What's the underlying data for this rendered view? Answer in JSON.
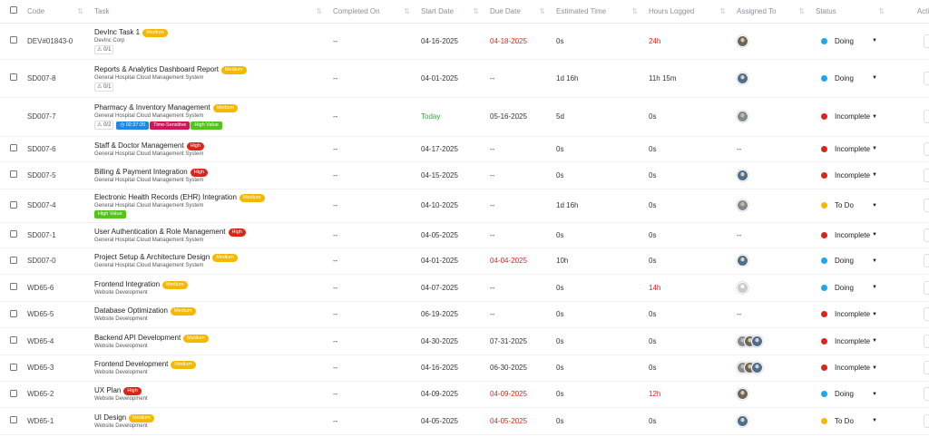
{
  "headers": {
    "code": "Code",
    "task": "Task",
    "completed": "Completed On",
    "start": "Start Date",
    "due": "Due Date",
    "estimated": "Estimated Time",
    "logged": "Hours Logged",
    "assigned": "Assigned To",
    "status": "Status",
    "action": "Action"
  },
  "colors": {
    "doing": "#1ea7e8",
    "incomplete": "#d9261c",
    "todo": "#f5b800",
    "medium": "#f5b800",
    "high": "#d9261c",
    "overdue": "#e0261c",
    "today": "#3aa33a"
  },
  "rows": [
    {
      "code": "DEV#01843-0",
      "task": "DevInc Task 1",
      "priority": "Medium",
      "project": "DevInc Corp",
      "subtasks": "0/1",
      "completed": "--",
      "start": "04-16-2025",
      "due": "04-18-2025",
      "due_overdue": true,
      "estimated": "0s",
      "logged": "24h",
      "logged_red": true,
      "assigned": "avatar",
      "status": "Doing",
      "status_key": "doing",
      "checkbox": true
    },
    {
      "code": "SD007-8",
      "task": "Reports & Analytics Dashboard Report",
      "priority": "Medium",
      "project": "General Hospital Cloud Management System",
      "subtasks": "0/1",
      "completed": "--",
      "start": "04-01-2025",
      "due": "--",
      "estimated": "1d 16h",
      "logged": "11h 15m",
      "assigned": "avatar",
      "status": "Doing",
      "status_key": "doing",
      "checkbox": true
    },
    {
      "code": "SD007-7",
      "task": "Pharmacy & Inventory Management",
      "priority": "Medium",
      "project": "General Hospital Cloud Management System",
      "subtasks": "0/2",
      "timer": "02:37:20",
      "labels": [
        "Time-Sensitive",
        "High Value"
      ],
      "completed": "--",
      "start": "Today",
      "start_today": true,
      "due": "05-16-2025",
      "estimated": "5d",
      "logged": "0s",
      "assigned": "avatar",
      "status": "Incomplete",
      "status_key": "incomplete",
      "checkbox": false
    },
    {
      "code": "SD007-6",
      "task": "Staff & Doctor Management",
      "priority": "High",
      "project": "General Hospital Cloud Management System",
      "completed": "--",
      "start": "04-17-2025",
      "due": "--",
      "estimated": "0s",
      "logged": "0s",
      "assigned": "--",
      "status": "Incomplete",
      "status_key": "incomplete",
      "checkbox": true
    },
    {
      "code": "SD007-5",
      "task": "Billing & Payment Integration",
      "priority": "High",
      "project": "General Hospital Cloud Management System",
      "completed": "--",
      "start": "04-15-2025",
      "due": "--",
      "estimated": "0s",
      "logged": "0s",
      "assigned": "avatar",
      "status": "Incomplete",
      "status_key": "incomplete",
      "checkbox": true
    },
    {
      "code": "SD007-4",
      "task": "Electronic Health Records (EHR) Integration",
      "priority": "Medium",
      "project": "General Hospital Cloud Management System",
      "labels": [
        "High Value"
      ],
      "completed": "--",
      "start": "04-10-2025",
      "due": "--",
      "estimated": "1d 16h",
      "logged": "0s",
      "assigned": "avatar",
      "status": "To Do",
      "status_key": "todo",
      "checkbox": true
    },
    {
      "code": "SD007-1",
      "task": "User Authentication & Role Management",
      "priority": "High",
      "project": "General Hospital Cloud Management System",
      "completed": "--",
      "start": "04-05-2025",
      "due": "--",
      "estimated": "0s",
      "logged": "0s",
      "assigned": "--",
      "status": "Incomplete",
      "status_key": "incomplete",
      "checkbox": true
    },
    {
      "code": "SD007-0",
      "task": "Project Setup & Architecture Design",
      "priority": "Medium",
      "project": "General Hospital Cloud Management System",
      "completed": "--",
      "start": "04-01-2025",
      "due": "04-04-2025",
      "due_overdue": true,
      "estimated": "10h",
      "logged": "0s",
      "assigned": "avatar",
      "status": "Doing",
      "status_key": "doing",
      "checkbox": true
    },
    {
      "code": "WD65-6",
      "task": "Frontend Integration",
      "priority": "Medium",
      "project": "Website Development",
      "completed": "--",
      "start": "04-07-2025",
      "due": "--",
      "estimated": "0s",
      "logged": "14h",
      "logged_red": true,
      "assigned": "blank",
      "status": "Doing",
      "status_key": "doing",
      "checkbox": true
    },
    {
      "code": "WD65-5",
      "task": "Database Optimization",
      "priority": "Medium",
      "project": "Website Development",
      "completed": "--",
      "start": "06-19-2025",
      "due": "--",
      "estimated": "0s",
      "logged": "0s",
      "assigned": "--",
      "status": "Incomplete",
      "status_key": "incomplete",
      "checkbox": true
    },
    {
      "code": "WD65-4",
      "task": "Backend API Development",
      "priority": "Medium",
      "project": "Website Development",
      "completed": "--",
      "start": "04-30-2025",
      "due": "07-31-2025",
      "estimated": "0s",
      "logged": "0s",
      "assigned": "multi",
      "status": "Incomplete",
      "status_key": "incomplete",
      "checkbox": true
    },
    {
      "code": "WD65-3",
      "task": "Frontend Development",
      "priority": "Medium",
      "project": "Website Development",
      "completed": "--",
      "start": "04-16-2025",
      "due": "06-30-2025",
      "estimated": "0s",
      "logged": "0s",
      "assigned": "multi",
      "status": "Incomplete",
      "status_key": "incomplete",
      "checkbox": true
    },
    {
      "code": "WD65-2",
      "task": "UX Plan",
      "priority": "High",
      "project": "Website Development",
      "completed": "--",
      "start": "04-09-2025",
      "due": "04-09-2025",
      "due_overdue": true,
      "estimated": "0s",
      "logged": "12h",
      "logged_red": true,
      "assigned": "avatar",
      "status": "Doing",
      "status_key": "doing",
      "checkbox": true
    },
    {
      "code": "WD65-1",
      "task": "UI Design",
      "priority": "Medium",
      "project": "Website Development",
      "completed": "--",
      "start": "04-05-2025",
      "due": "04-05-2025",
      "due_overdue": true,
      "estimated": "0s",
      "logged": "0s",
      "assigned": "avatar",
      "status": "To Do",
      "status_key": "todo",
      "checkbox": true
    }
  ]
}
